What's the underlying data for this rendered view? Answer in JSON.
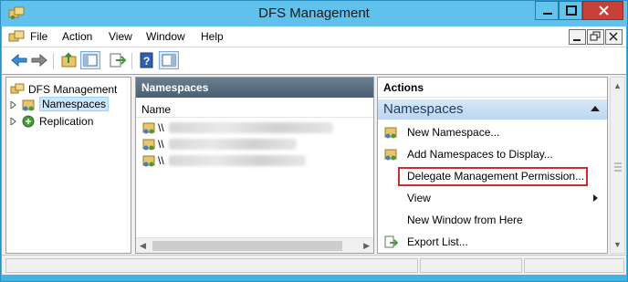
{
  "window": {
    "title": "DFS Management"
  },
  "menu": [
    "File",
    "Action",
    "View",
    "Window",
    "Help"
  ],
  "tree": {
    "root": "DFS Management",
    "items": [
      {
        "label": "Namespaces",
        "selected": true,
        "icon": "namespaces-icon"
      },
      {
        "label": "Replication",
        "selected": false,
        "icon": "replication-icon"
      }
    ]
  },
  "center": {
    "header": "Namespaces",
    "column": "Name",
    "rows": [
      {
        "prefix": "\\\\"
      },
      {
        "prefix": "\\\\"
      },
      {
        "prefix": "\\\\"
      }
    ]
  },
  "actions": {
    "header": "Actions",
    "group": "Namespaces",
    "items": [
      {
        "label": "New Namespace...",
        "icon": "new-namespace-icon"
      },
      {
        "label": "Add Namespaces to Display...",
        "icon": "add-namespaces-icon"
      },
      {
        "label": "Delegate Management Permission...",
        "icon": "",
        "highlighted": true
      },
      {
        "label": "View",
        "icon": "",
        "submenu": true
      },
      {
        "label": "New Window from Here",
        "icon": ""
      },
      {
        "label": "Export List...",
        "icon": "export-icon"
      }
    ]
  },
  "colors": {
    "titlebar": "#5fc1ec",
    "highlight": "#d22b2b",
    "pane_header": "#4b5e72"
  }
}
